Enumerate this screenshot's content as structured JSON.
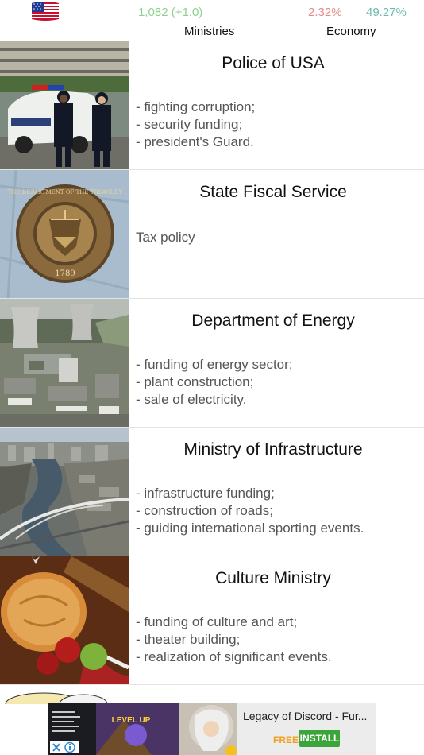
{
  "header": {
    "flag_icon": "us-flag-icon",
    "ministries_stat": "1,082 (+1.0)",
    "economy_change": "2.32%",
    "economy_value": "49.27%",
    "ministries_label": "Ministries",
    "economy_label": "Economy",
    "colors": {
      "ministries_stat": "#8fd18f",
      "economy_change": "#e58b8b",
      "economy_value": "#6fb8b1"
    }
  },
  "ministries": [
    {
      "title": "Police of USA",
      "image": "police-photo",
      "desc": [
        "- fighting corruption;",
        "- security funding;",
        "- president's Guard."
      ]
    },
    {
      "title": "State Fiscal Service",
      "image": "treasury-seal-photo",
      "desc": [
        "Tax policy"
      ]
    },
    {
      "title": "Department of Energy",
      "image": "power-plant-photo",
      "desc": [
        "- funding of energy sector;",
        "- plant construction;",
        "- sale of electricity."
      ]
    },
    {
      "title": "Ministry of Infrastructure",
      "image": "city-bridge-photo",
      "desc": [
        "- infrastructure funding;",
        "- construction of roads;",
        "- guiding international sporting events."
      ]
    },
    {
      "title": "Culture Ministry",
      "image": "pie-apples-photo",
      "desc": [
        "- funding of culture and art;",
        "- theater building;",
        "- realization of significant events."
      ]
    }
  ],
  "seal": {
    "top": "THE DEPARTMENT OF THE TREASURY",
    "year": "1789"
  },
  "ad": {
    "title": "Legacy of Discord - Fur...",
    "free_label": "FREE",
    "install_label": "INSTALL",
    "banner_text": "LEVEL UP"
  }
}
